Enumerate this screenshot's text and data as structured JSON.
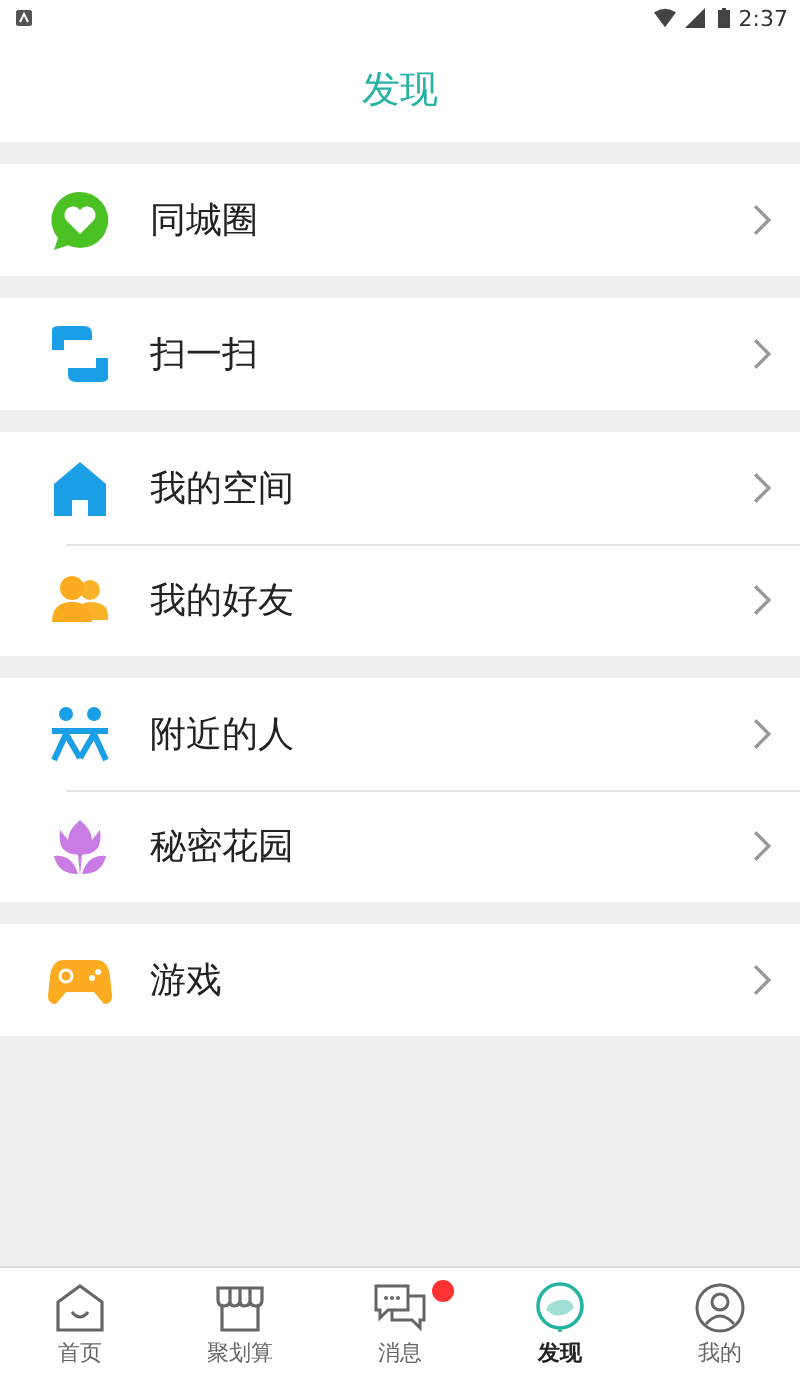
{
  "status_bar": {
    "time": "2:37"
  },
  "header": {
    "title": "发现"
  },
  "groups": [
    {
      "items": [
        {
          "kind": "chat-heart",
          "label": "同城圈"
        }
      ]
    },
    {
      "items": [
        {
          "kind": "scan",
          "label": "扫一扫"
        }
      ]
    },
    {
      "items": [
        {
          "kind": "house",
          "label": "我的空间"
        },
        {
          "kind": "friends",
          "label": "我的好友"
        }
      ]
    },
    {
      "items": [
        {
          "kind": "people",
          "label": "附近的人"
        },
        {
          "kind": "flower",
          "label": "秘密花园"
        }
      ]
    },
    {
      "items": [
        {
          "kind": "gamepad",
          "label": "游戏"
        }
      ]
    }
  ],
  "tabs": [
    {
      "kind": "home",
      "label": "首页",
      "selected": false,
      "badge": false
    },
    {
      "kind": "shop",
      "label": "聚划算",
      "selected": false,
      "badge": false
    },
    {
      "kind": "message",
      "label": "消息",
      "selected": false,
      "badge": true
    },
    {
      "kind": "discover",
      "label": "发现",
      "selected": true,
      "badge": false
    },
    {
      "kind": "me",
      "label": "我的",
      "selected": false,
      "badge": false
    }
  ]
}
